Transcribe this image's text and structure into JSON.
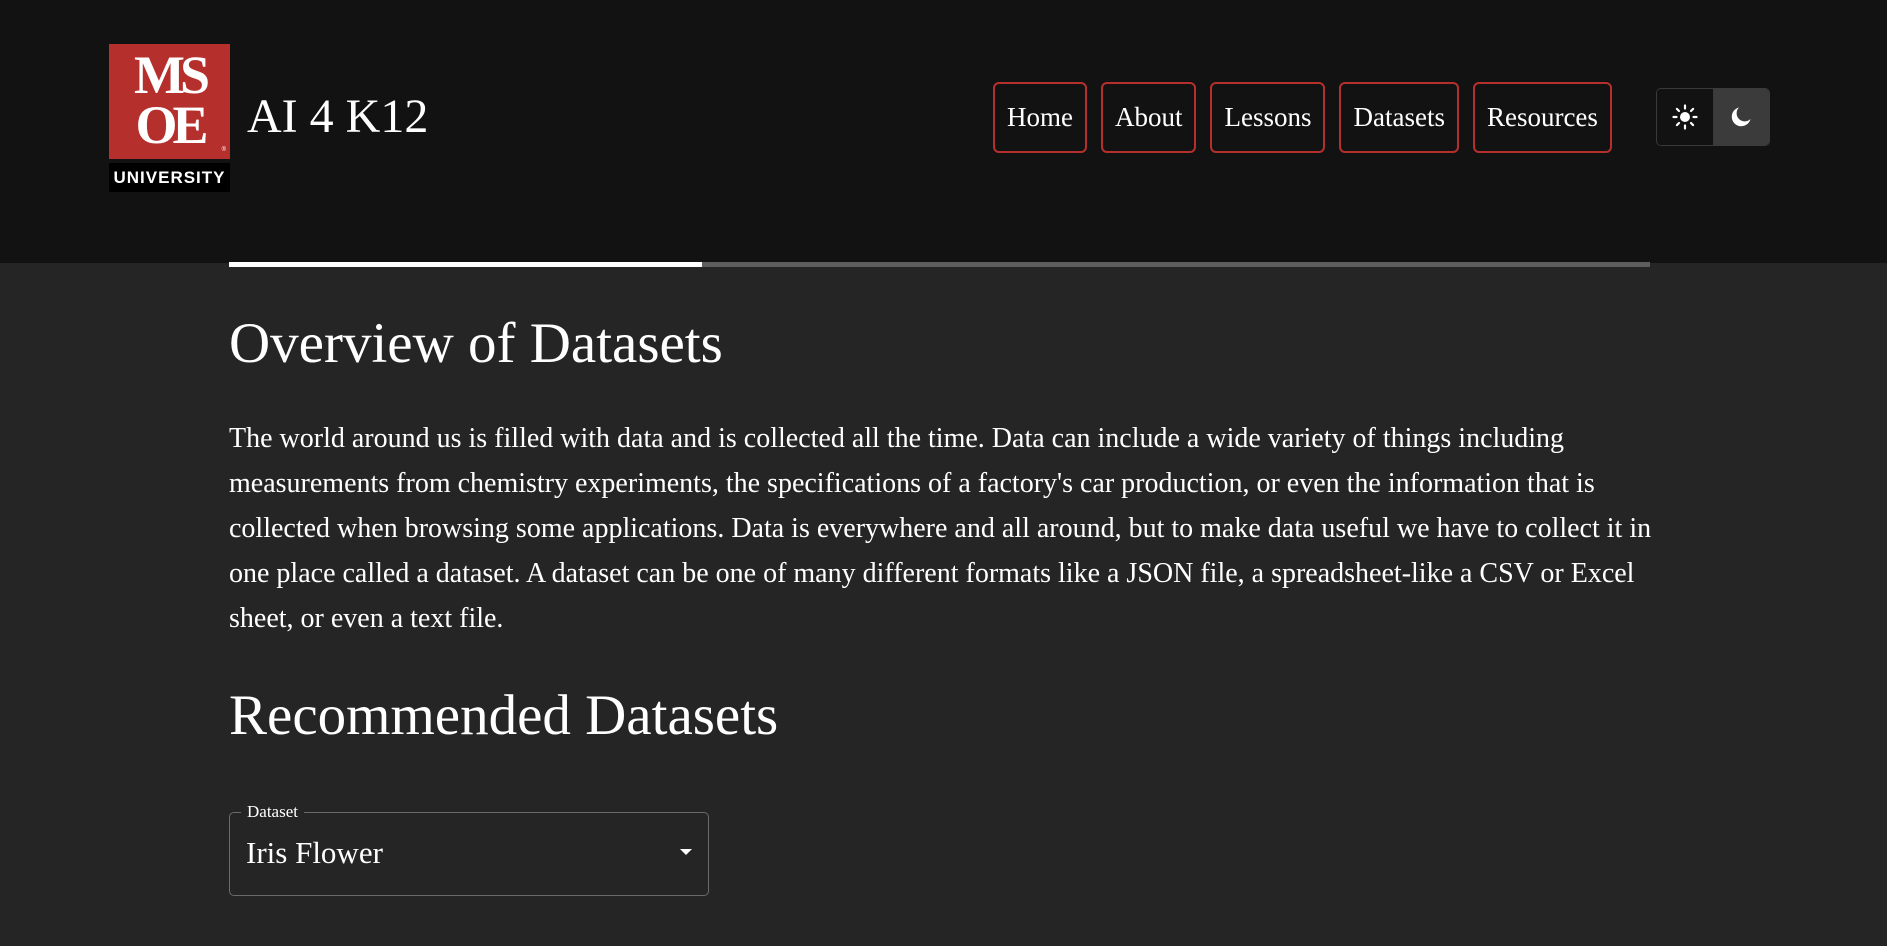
{
  "header": {
    "logo": {
      "letters": "MSOE",
      "subtitle": "UNIVERSITY"
    },
    "title": "AI 4 K12",
    "nav": [
      {
        "label": "Home"
      },
      {
        "label": "About"
      },
      {
        "label": "Lessons"
      },
      {
        "label": "Datasets"
      },
      {
        "label": "Resources"
      }
    ],
    "theme_toggle": {
      "options": [
        "sun-icon",
        "moon-icon"
      ],
      "selected": "dark"
    }
  },
  "progress": {
    "value_fraction": 0.333
  },
  "main": {
    "overview_heading": "Overview of Datasets",
    "overview_text": "The world around us is filled with data and is collected all the time. Data can include a wide variety of things including measurements from chemistry experiments, the specifications of a factory's car production, or even the information that is collected when browsing some applications. Data is everywhere and all around, but to make data useful we have to collect it in one place called a dataset. A dataset can be one of many different formats like a JSON file, a spreadsheet-like a CSV or Excel sheet, or even a text file.",
    "recommended_heading": "Recommended Datasets",
    "dataset_select": {
      "label": "Dataset",
      "value": "Iris Flower"
    }
  },
  "colors": {
    "accent_red": "#b5302d",
    "header_bg": "#121212",
    "page_bg": "#252525",
    "text": "#ffffff"
  }
}
